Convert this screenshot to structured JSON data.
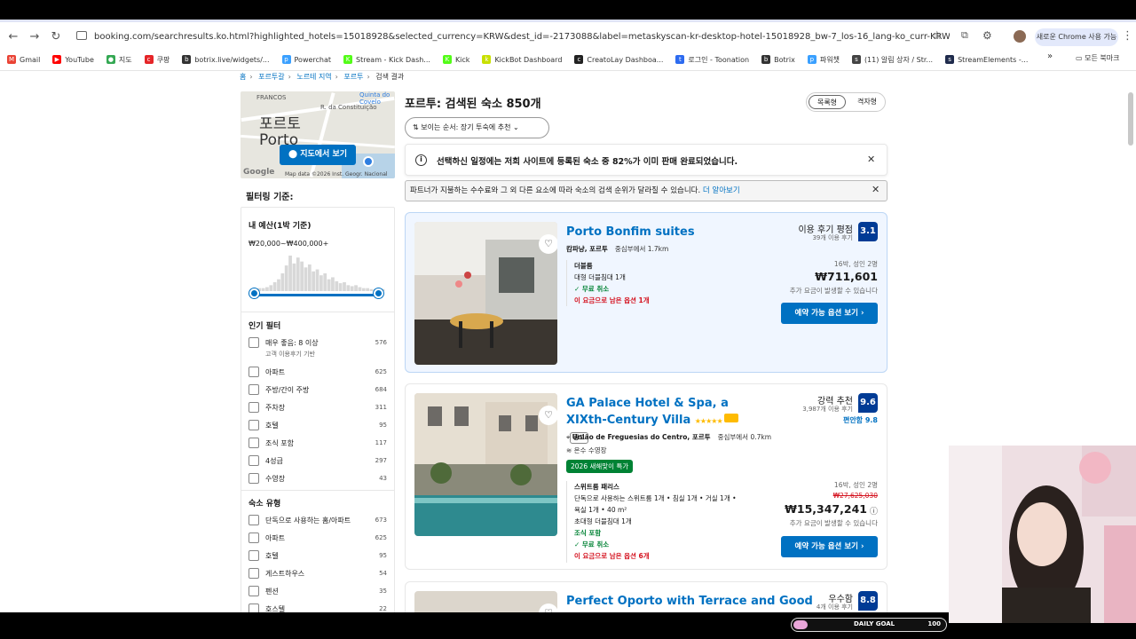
{
  "browser": {
    "url": "booking.com/searchresults.ko.html?highlighted_hotels=15018928&selected_currency=KRW&dest_id=-2173088&label=metaskyscan-kr-desktop-hotel-15018928_bw-7_los-16_lang-ko_curr-KRW_group-3_gst-2_cid-202603...",
    "new_chrome_label": "새로운 Chrome 사용 가능",
    "bookmarks": [
      {
        "label": "Gmail",
        "color": "#ea4335",
        "glyph": "M"
      },
      {
        "label": "YouTube",
        "color": "#ff0000",
        "glyph": "▶"
      },
      {
        "label": "지도",
        "color": "#34a853",
        "glyph": "●"
      },
      {
        "label": "쿠팡",
        "color": "#e52528",
        "glyph": "c"
      },
      {
        "label": "botrix.live/widgets/...",
        "color": "#333333",
        "glyph": "b"
      },
      {
        "label": "Powerchat",
        "color": "#3aa0ff",
        "glyph": "p"
      },
      {
        "label": "Stream - Kick Dash...",
        "color": "#53fc18",
        "glyph": "K"
      },
      {
        "label": "Kick",
        "color": "#53fc18",
        "glyph": "K"
      },
      {
        "label": "KickBot Dashboard",
        "color": "#c8e000",
        "glyph": "k"
      },
      {
        "label": "CreatoLay Dashboa...",
        "color": "#222222",
        "glyph": "c"
      },
      {
        "label": "로그인 - Toonation",
        "color": "#2d6bf0",
        "glyph": "t"
      },
      {
        "label": "Botrix",
        "color": "#333333",
        "glyph": "b"
      },
      {
        "label": "파워챗",
        "color": "#3aa0ff",
        "glyph": "p"
      },
      {
        "label": "(11) 알림 상자 / Str...",
        "color": "#444444",
        "glyph": "s"
      },
      {
        "label": "StreamElements -...",
        "color": "#1f2b4c",
        "glyph": "s"
      }
    ],
    "bookmarks_more": "»",
    "all_bookmarks": "모든 북마크"
  },
  "breadcrumb": [
    "홈",
    "포르투갈",
    "노르테 지역",
    "포르투",
    "검색 결과"
  ],
  "map": {
    "label_ko": "포르토",
    "label_en": "Porto",
    "street1": "FRANCOS",
    "street2": "R. da Constituição",
    "street3": "Quinta do Covelo",
    "button": "지도에서 보기",
    "credit": "Map data ©2026 Inst. Geogr. Nacional",
    "google": "Google"
  },
  "filters": {
    "title": "필터링 기준:",
    "budget_title": "내 예산(1박 기준)",
    "budget_range": "₩20,000~₩400,000+",
    "histogram_heights": [
      2,
      3,
      3,
      4,
      6,
      9,
      12,
      18,
      26,
      36,
      28,
      34,
      30,
      24,
      27,
      20,
      22,
      16,
      18,
      12,
      14,
      10,
      8,
      9,
      6,
      5,
      6,
      4,
      3,
      3,
      2,
      2,
      3,
      2
    ],
    "popular_title": "인기 필터",
    "popular": [
      {
        "label": "매우 좋음: 8 이상",
        "sub": "고객 이용후기 기반",
        "count": "576"
      },
      {
        "label": "아파트",
        "count": "625"
      },
      {
        "label": "주방/간이 주방",
        "count": "684"
      },
      {
        "label": "주차장",
        "count": "311"
      },
      {
        "label": "호텔",
        "count": "95"
      },
      {
        "label": "조식 포함",
        "count": "117"
      },
      {
        "label": "4성급",
        "count": "297"
      },
      {
        "label": "수영장",
        "count": "43"
      }
    ],
    "type_title": "숙소 유형",
    "types": [
      {
        "label": "단독으로 사용하는 홈/아파트",
        "count": "673"
      },
      {
        "label": "아파트",
        "count": "625"
      },
      {
        "label": "호텔",
        "count": "95"
      },
      {
        "label": "게스트하우스",
        "count": "54"
      },
      {
        "label": "펜션",
        "count": "35"
      },
      {
        "label": "호스텔",
        "count": "22"
      }
    ]
  },
  "results": {
    "title": "포르투: 검색된 숙소 850개",
    "view_list": "목록형",
    "view_grid": "격자형",
    "sort": "보이는 순서: 장기 투숙에 추천",
    "alert": "선택하신 일정에는 저희 사이트에 등록된 숙소 중 82%가 이미 판매 완료되었습니다.",
    "notice": "파트너가 지불하는 수수료와 그 외 다른 요소에 따라 숙소의 검색 순위가 달라질 수 있습니다.",
    "notice_link": "더 알아보기"
  },
  "hotels": [
    {
      "name": "Porto Bonfim suites",
      "area": "캄파냥, 포르투",
      "distance": "중심부에서 1.7km",
      "room": "더블룸",
      "bed": "대형 더블침대 1개",
      "cancel": "무료 취소",
      "left": "이 요금으로 남은 옵션 1개",
      "score_label": "이용 후기 평점",
      "reviews": "39개 이용 후기",
      "score": "3.1",
      "meta": "16박, 성인 2명",
      "price": "₩711,601",
      "extra": "추가 요금이 발생할 수 있습니다",
      "cta": "예약 가능 옵션 보기"
    },
    {
      "name": "GA Palace Hotel & Spa, a XIXth-Century Villa",
      "stars": "★★★★★",
      "ad": "광고",
      "area": "União de Freguesias do Centro, 포르투",
      "distance": "중심부에서 0.7km",
      "pool": "온수 수영장",
      "deal": "2026 새해맞이 특가",
      "room": "스위트룸 패리스",
      "desc1": "단독으로 사용하는 스위트룸 1개 • 침실 1개 • 거실 1개 •",
      "desc2": "욕실 1개 • 40 m²",
      "bed": "초대형 더블침대 1개",
      "breakfast": "조식 포함",
      "cancel": "무료 취소",
      "left": "이 요금으로 남은 옵션 6개",
      "score_label": "강력 추천",
      "reviews": "3,987개 이용 후기",
      "comfort": "편안함 9.8",
      "score": "9.6",
      "meta": "16박, 성인 2명",
      "old_price": "₩27,625,030",
      "price": "₩15,347,241",
      "extra": "추가 요금이 발생할 수 있습니다",
      "cta": "예약 가능 옵션 보기"
    },
    {
      "name": "Perfect Oporto with Terrace and Good",
      "score_label": "우수함",
      "reviews": "4개 이용 후기",
      "score": "8.8"
    }
  ],
  "overlay": {
    "goal_label": "DAILY GOAL",
    "goal_value": "100"
  }
}
